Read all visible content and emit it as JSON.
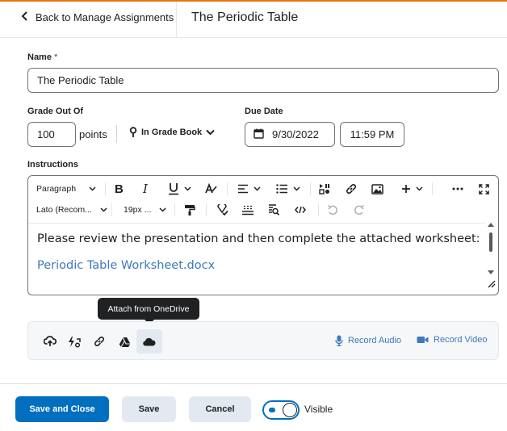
{
  "header": {
    "back_label": "Back to Manage Assignments",
    "title": "The Periodic Table"
  },
  "form": {
    "name_label": "Name",
    "name_required": "*",
    "name_value": "The Periodic Table",
    "grade_label": "Grade Out Of",
    "grade_value": "100",
    "points_label": "points",
    "gradebook_label": "In Grade Book",
    "due_label": "Due Date",
    "due_date": "9/30/2022",
    "due_time": "11:59 PM",
    "instructions_label": "Instructions"
  },
  "editor": {
    "paragraph_format": "Paragraph",
    "font_family": "Lato (Recom...",
    "font_size": "19px ...",
    "content_text": "Please review the presentation and then complete the attached worksheet:",
    "content_link": "Periodic Table Worksheet.docx"
  },
  "attachments": {
    "tooltip": "Attach from OneDrive",
    "record_audio": "Record Audio",
    "record_video": "Record Video"
  },
  "footer": {
    "save_close": "Save and Close",
    "save": "Save",
    "cancel": "Cancel",
    "visible_label": "Visible"
  },
  "colors": {
    "primary": "#006fbf",
    "link": "#3d7aba",
    "accent": "#e87511"
  }
}
